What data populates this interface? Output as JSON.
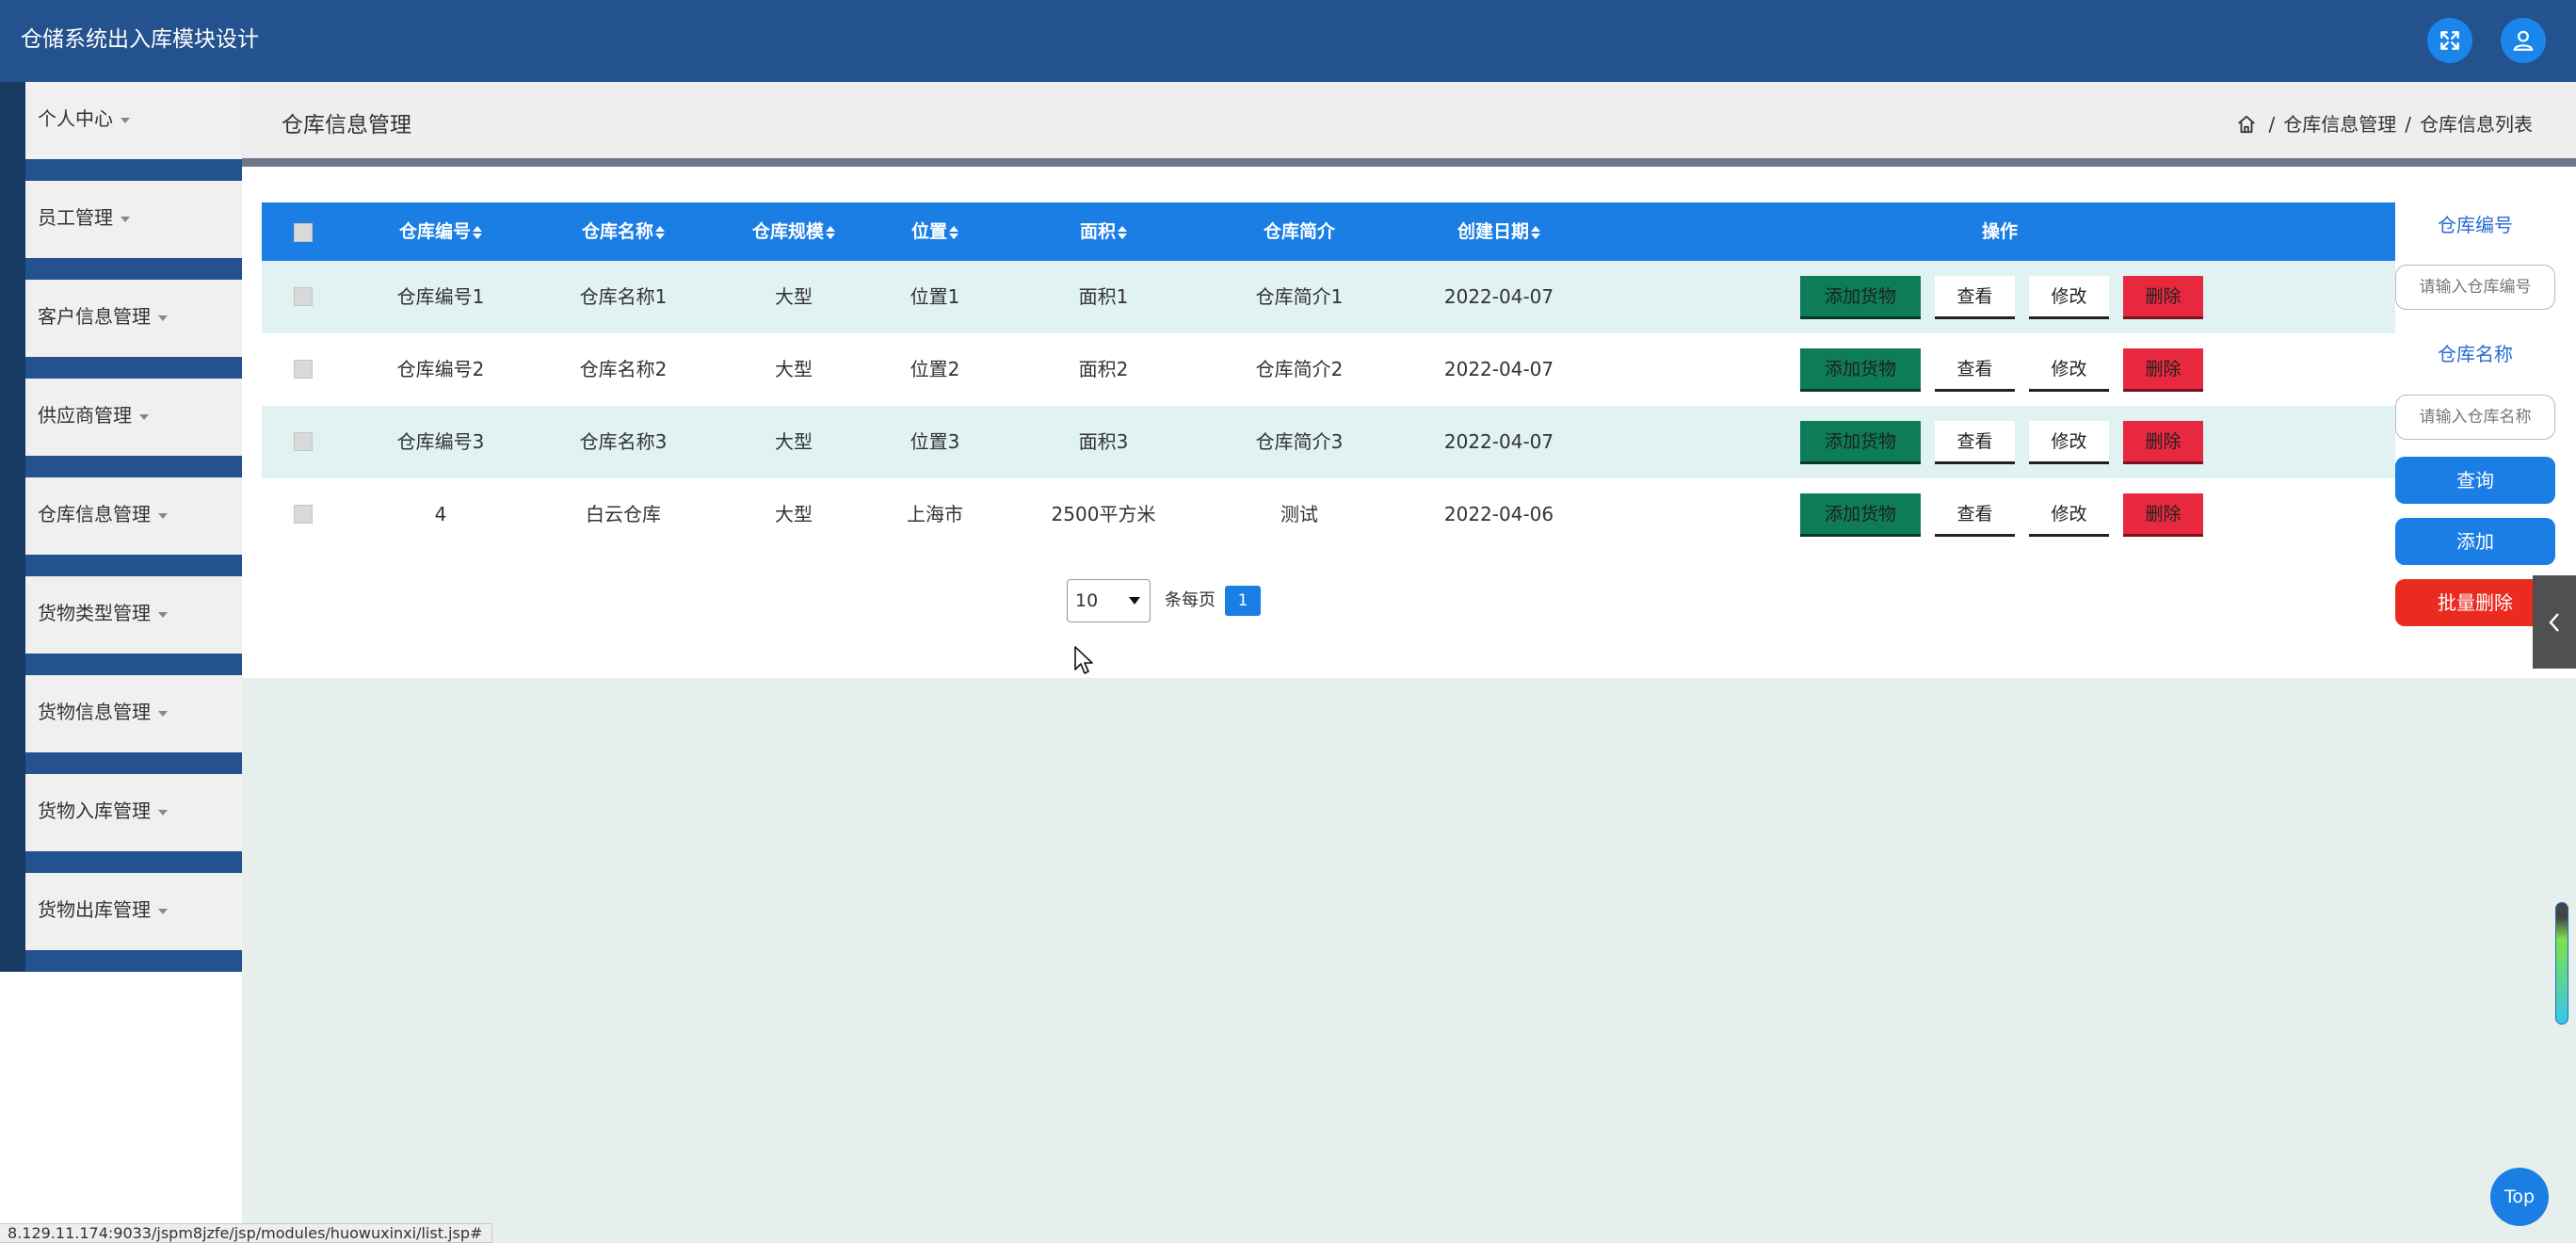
{
  "header": {
    "app_title": "仓储系统出入库模块设计"
  },
  "sidebar": {
    "items": [
      {
        "label": "个人中心"
      },
      {
        "label": "员工管理"
      },
      {
        "label": "客户信息管理"
      },
      {
        "label": "供应商管理"
      },
      {
        "label": "仓库信息管理"
      },
      {
        "label": "货物类型管理"
      },
      {
        "label": "货物信息管理"
      },
      {
        "label": "货物入库管理"
      },
      {
        "label": "货物出库管理"
      }
    ]
  },
  "main": {
    "page_title": "仓库信息管理",
    "breadcrumb": {
      "items": [
        "仓库信息管理",
        "仓库信息列表"
      ],
      "separator": "/"
    }
  },
  "table": {
    "columns": [
      "仓库编号",
      "仓库名称",
      "仓库规模",
      "位置",
      "面积",
      "仓库简介",
      "创建日期",
      "操作"
    ],
    "rows": [
      {
        "code": "仓库编号1",
        "name": "仓库名称1",
        "scale": "大型",
        "location": "位置1",
        "area": "面积1",
        "intro": "仓库简介1",
        "date": "2022-04-07"
      },
      {
        "code": "仓库编号2",
        "name": "仓库名称2",
        "scale": "大型",
        "location": "位置2",
        "area": "面积2",
        "intro": "仓库简介2",
        "date": "2022-04-07"
      },
      {
        "code": "仓库编号3",
        "name": "仓库名称3",
        "scale": "大型",
        "location": "位置3",
        "area": "面积3",
        "intro": "仓库简介3",
        "date": "2022-04-07"
      },
      {
        "code": "4",
        "name": "白云仓库",
        "scale": "大型",
        "location": "上海市",
        "area": "2500平方米",
        "intro": "测试",
        "date": "2022-04-06"
      }
    ],
    "actions": {
      "add_goods": "添加货物",
      "view": "查看",
      "edit": "修改",
      "delete": "删除"
    }
  },
  "pagination": {
    "page_size": "10",
    "per_page_label": "条每页",
    "current_page": "1"
  },
  "search": {
    "code_label": "仓库编号",
    "code_placeholder": "请输入仓库编号",
    "name_label": "仓库名称",
    "name_placeholder": "请输入仓库名称",
    "query_button": "查询",
    "add_button": "添加",
    "batch_delete_button": "批量删除"
  },
  "back_to_top": "Top",
  "status_bar_url": "8.129.11.174:9033/jspm8jzfe/jsp/modules/huowuxinxi/list.jsp#",
  "colors": {
    "topbar": "#24528f",
    "primary": "#1b7ee5",
    "danger": "#e8283e",
    "success": "#0d7c57",
    "row_alt": "#e0f2f1"
  }
}
